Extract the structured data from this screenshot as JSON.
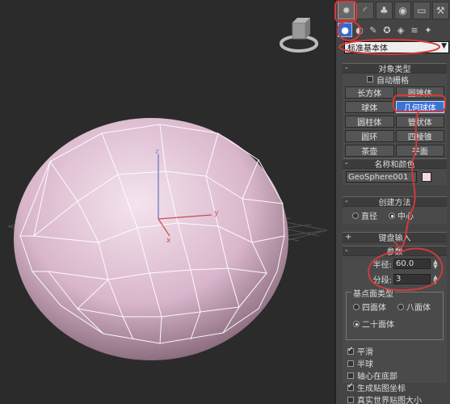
{
  "top_tabs": [
    {
      "icon": "sun-icon",
      "glyph": "✸"
    },
    {
      "icon": "curve-icon",
      "glyph": "◜"
    },
    {
      "icon": "hierarchy-icon",
      "glyph": "♣"
    },
    {
      "icon": "motion-icon",
      "glyph": "◉"
    },
    {
      "icon": "display-icon",
      "glyph": "▭"
    },
    {
      "icon": "utilities-icon",
      "glyph": "⚒"
    }
  ],
  "sub_tabs": [
    {
      "icon": "geometry-icon",
      "glyph": "●"
    },
    {
      "icon": "shapes-icon",
      "glyph": "◐"
    },
    {
      "icon": "lights-icon",
      "glyph": "✎"
    },
    {
      "icon": "cameras-icon",
      "glyph": "✪"
    },
    {
      "icon": "helpers-icon",
      "glyph": "◈"
    },
    {
      "icon": "spacewarps-icon",
      "glyph": "≋"
    },
    {
      "icon": "systems-icon",
      "glyph": "✦"
    }
  ],
  "dropdown": {
    "value": "标准基本体"
  },
  "object_type": {
    "title": "对象类型",
    "autogrid": "自动栅格",
    "buttons": [
      "长方体",
      "圆锥体",
      "球体",
      "几何球体",
      "圆柱体",
      "管状体",
      "圆环",
      "四棱锥",
      "茶壶",
      "平面"
    ],
    "active_button_index": 3
  },
  "name_color": {
    "title": "名称和颜色",
    "name": "GeoSphere001",
    "color": "#f3d9e6"
  },
  "creation_method": {
    "title": "创建方法",
    "options": [
      "直径",
      "中心"
    ],
    "selected": "中心"
  },
  "keyboard_entry": {
    "title": "键盘输入"
  },
  "parameters": {
    "title": "参数",
    "radius_label": "半径:",
    "radius_value": "60.0",
    "segments_label": "分段:",
    "segments_value": "3",
    "base_type_title": "基点面类型",
    "base_types": [
      "四面体",
      "八面体",
      "二十面体"
    ],
    "base_selected": "二十面体",
    "checks": [
      {
        "label": "平滑",
        "checked": true
      },
      {
        "label": "半球",
        "checked": false
      },
      {
        "label": "轴心在底部",
        "checked": false
      },
      {
        "label": "生成贴图坐标",
        "checked": true
      },
      {
        "label": "真实世界贴图大小",
        "checked": false
      }
    ]
  },
  "viewport": {
    "axis_labels": {
      "x": "x",
      "y": "y",
      "z": "z"
    },
    "sphere_color": "#e6c6d9"
  }
}
